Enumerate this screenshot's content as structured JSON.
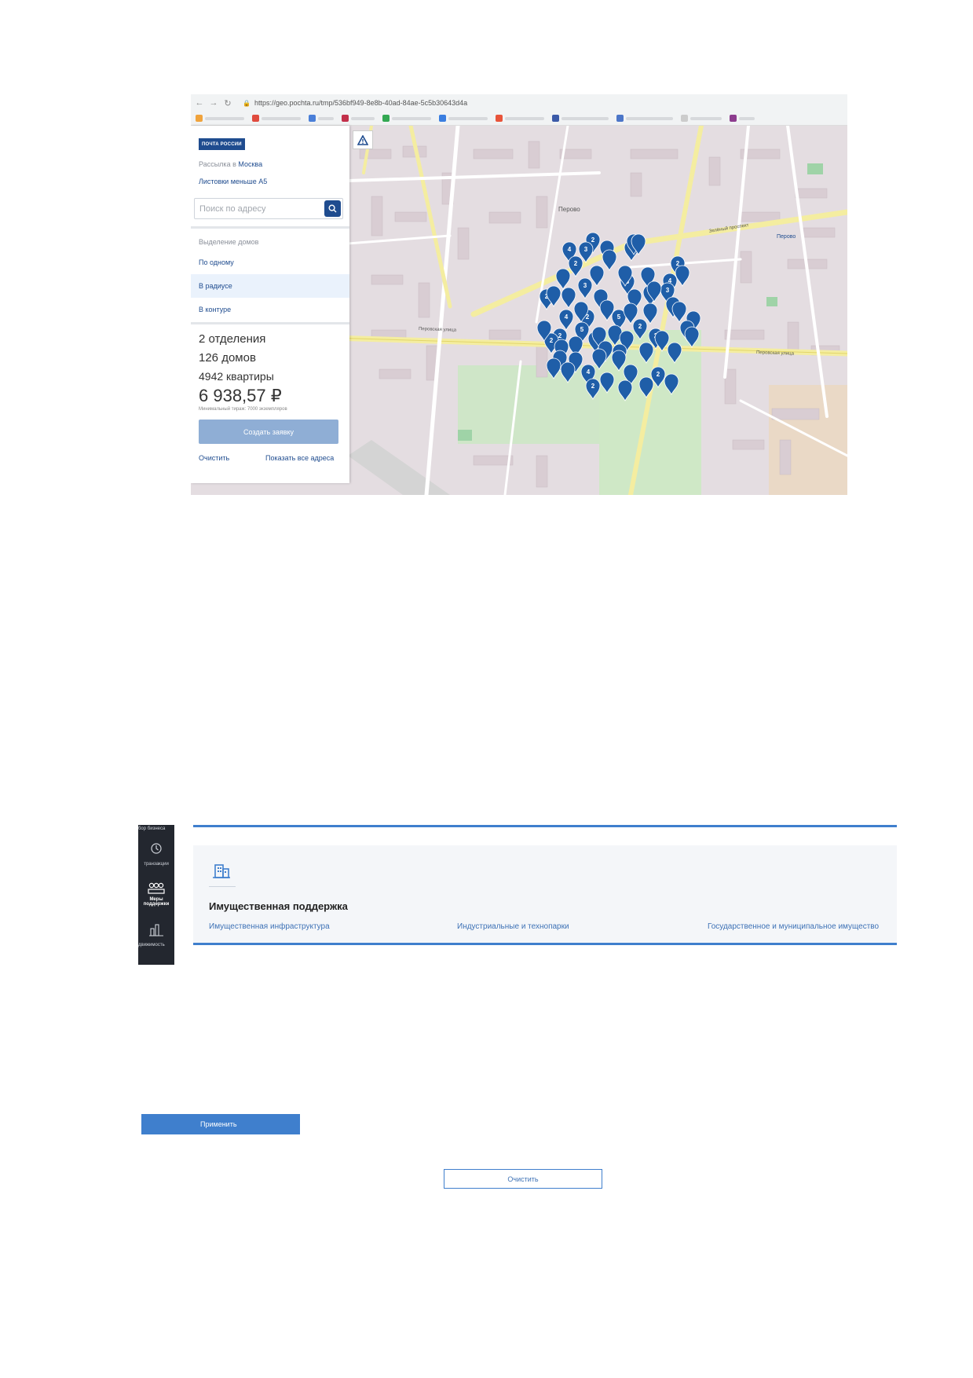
{
  "browser": {
    "url": "https://geo.pochta.ru/tmp/536bf949-8e8b-40ad-84ae-5c5b30643d4a"
  },
  "panel": {
    "logo": "ПОЧТА РОССИИ",
    "mailing_prefix": "Рассылка в",
    "city": "Москва",
    "leaflets": "Листовки меньше А5",
    "search_placeholder": "Поиск по адресу",
    "selection_title": "Выделение домов",
    "modes": [
      "По одному",
      "В радиусе",
      "В контуре"
    ],
    "active_mode": "В радиусе",
    "offices": "2 отделения",
    "houses": "126 домов",
    "apartments": "4942 квартиры",
    "price": "6 938,57 ₽",
    "min_run": "Минимальный тираж: 7000 экземпляров",
    "create_button": "Создать заявку",
    "clear_link": "Очистить",
    "show_all_link": "Показать все адреса"
  },
  "map": {
    "district_labels": [
      "Перово",
      "Перово"
    ],
    "street_labels": [
      "Перовская улица",
      "Зелёный проспект",
      "Перовская улица"
    ],
    "marker_color": "#1f5ea8",
    "cluster_counts": [
      "2",
      "4",
      "3",
      "2",
      "8",
      "2",
      "3",
      "3",
      "4",
      "3",
      "2",
      "3",
      "4",
      "2",
      "5",
      "5",
      "2",
      "4",
      "2",
      "2",
      "2",
      "4",
      "2",
      "2"
    ]
  },
  "support": {
    "sidebar_items": [
      "бор бизнеса",
      "транзакции",
      "Меры поддержки",
      "движимость"
    ],
    "title": "Имущественная поддержка",
    "links": [
      "Имущественная инфраструктура",
      "Индустриальные и технопарки",
      "Государственное и муниципальное имущество"
    ]
  },
  "buttons": {
    "apply": "Применить",
    "clear": "Очистить"
  },
  "colors": {
    "brand": "#1f4c8f",
    "accent": "#3f7fcd"
  }
}
